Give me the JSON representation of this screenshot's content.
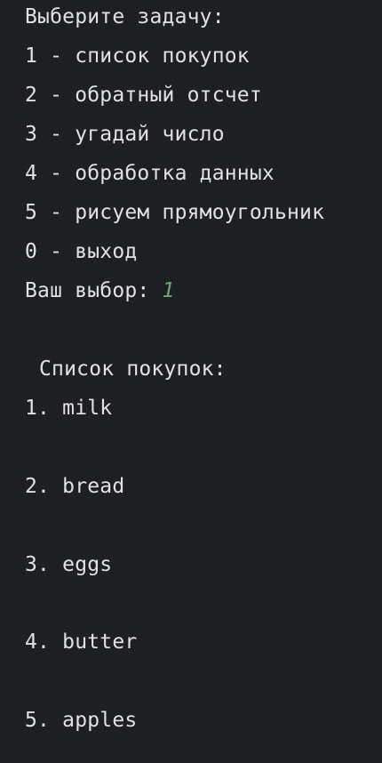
{
  "console": {
    "menu": {
      "prompt_title": "Выберите задачу:",
      "options": [
        "1 - список покупок",
        "2 - обратный отсчет",
        "3 - угадай число",
        "4 - обработка данных",
        "5 - рисуем прямоугольник",
        "0 - выход"
      ],
      "choice_label": "Ваш выбор: ",
      "choice_value": "1"
    },
    "shopping_list": {
      "header": "Список покупок:",
      "items": [
        "1. milk",
        "2. bread",
        "3. eggs",
        "4. butter",
        "5. apples"
      ]
    },
    "colors": {
      "background": "#1e1f22",
      "text": "#dfe1e5",
      "user_input": "#6aab73"
    }
  }
}
